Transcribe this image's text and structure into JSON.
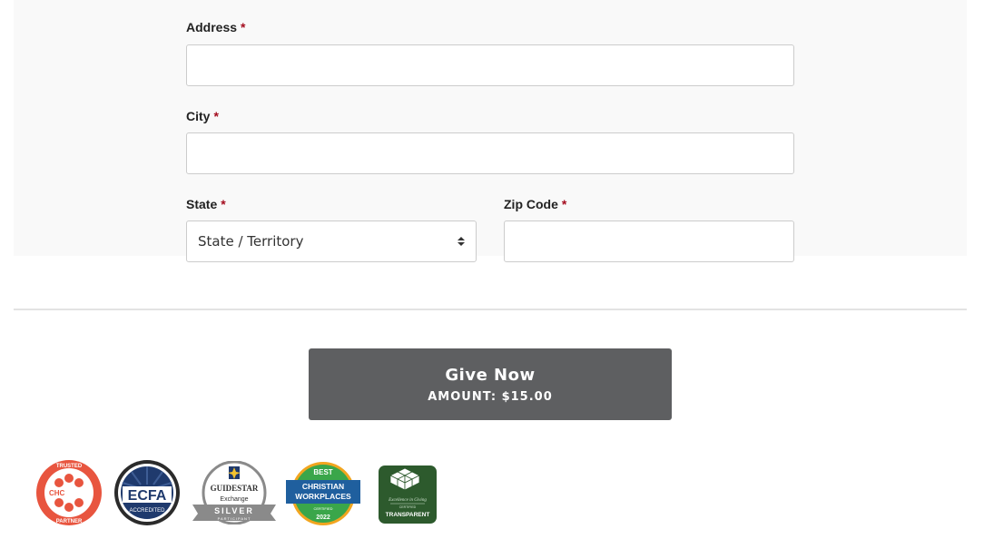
{
  "form": {
    "address": {
      "label": "Address",
      "required_mark": "*",
      "value": ""
    },
    "city": {
      "label": "City",
      "required_mark": "*",
      "value": ""
    },
    "state": {
      "label": "State",
      "required_mark": "*",
      "selected": "State / Territory"
    },
    "zip": {
      "label": "Zip Code",
      "required_mark": "*",
      "value": ""
    }
  },
  "give_button": {
    "title": "Give Now",
    "amount": "AMOUNT: $15.00"
  },
  "badges": [
    {
      "name": "chc-trusted-partner-badge",
      "top_text": "TRUSTED",
      "middle_text": "CHC",
      "bottom_text": "PARTNER",
      "color": "#e8553f"
    },
    {
      "name": "ecfa-accredited-badge",
      "top_text": "ECFA",
      "bottom_text": "ACCREDITED",
      "color": "#1f3a6d"
    },
    {
      "name": "guidestar-silver-badge",
      "top_text": "GUIDESTAR",
      "middle_text": "Exchange",
      "bottom_text": "SILVER",
      "sub_text": "PARTICIPANT",
      "color": "#8a8a8a"
    },
    {
      "name": "best-christian-workplaces-badge",
      "top_text": "BEST",
      "middle_text": "CHRISTIAN",
      "middle_text_2": "WORKPLACES",
      "sub_text": "CERTIFIED",
      "bottom_text": "2022",
      "color": "#3aa64a"
    },
    {
      "name": "excellence-in-giving-badge",
      "middle_text": "Excellence in Giving",
      "sub_text": "CERTIFIED",
      "bottom_text": "TRANSPARENT",
      "color": "#2d5a2d"
    }
  ],
  "colors": {
    "required": "#a40c1e",
    "button": "#5e5f61",
    "panel": "#f9f9f9"
  }
}
